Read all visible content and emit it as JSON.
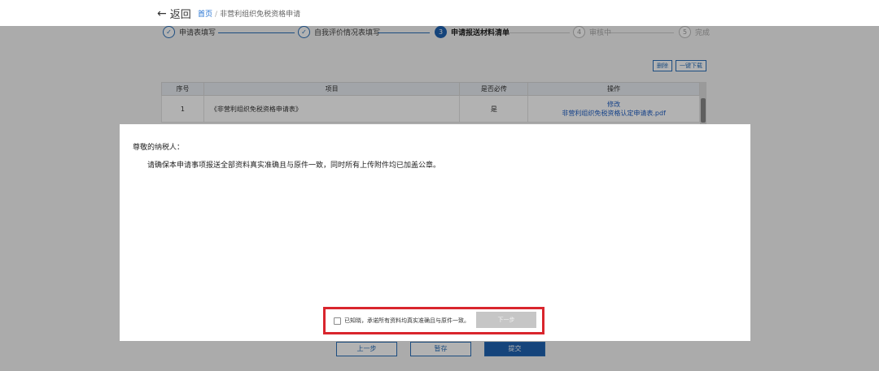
{
  "header": {
    "back_label": "返回",
    "breadcrumb": {
      "home": "首页",
      "separator": "/",
      "current": "非营利组织免税资格申请"
    }
  },
  "steps": [
    {
      "index": "1",
      "label": "申请表填写",
      "state": "done"
    },
    {
      "index": "2",
      "label": "自我评价情况表填写",
      "state": "done"
    },
    {
      "index": "3",
      "label": "申请报送材料清单",
      "state": "current"
    },
    {
      "index": "4",
      "label": "审核中",
      "state": "todo"
    },
    {
      "index": "5",
      "label": "完成",
      "state": "todo"
    }
  ],
  "table_actions": {
    "delete_label": "删除",
    "download_label": "一键下载"
  },
  "table": {
    "headers": [
      "序号",
      "项目",
      "是否必传",
      "操作"
    ],
    "rows": [
      {
        "no": "1",
        "item": "《非营利组织免税资格申请表》",
        "required": "是",
        "op_edit": "修改",
        "op_file": "非营利组织免税资格认定申请表.pdf"
      }
    ]
  },
  "bottom_buttons": {
    "prev": "上一步",
    "save": "暂存",
    "submit": "提交"
  },
  "modal": {
    "greeting": "尊敬的纳税人：",
    "message": "请确保本申请事项报送全部资料真实准确且与原件一致，同时所有上传附件均已加盖公章。",
    "agree_label": "已知晓，承诺所有资料均真实准确且与原件一致。",
    "agree_checked": false,
    "next_label": "下一步"
  },
  "colors": {
    "accent": "#1f62b0",
    "highlight": "#d9252d",
    "disabled": "#c6c6c6"
  }
}
